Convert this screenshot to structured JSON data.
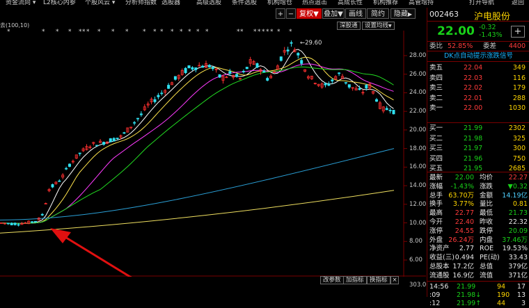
{
  "menubar": {
    "items": [
      "资金流向 ▾",
      "L2核心内参",
      "个股风云 ▾",
      "分析师指数",
      "选股器",
      "高级选股",
      "条件选股",
      "机构增仓",
      "热点追击",
      "高成长性",
      "机构推荐",
      "高管增持",
      "打开导航",
      "返回"
    ]
  },
  "toolbar": {
    "plus": "+",
    "minus": "−",
    "right_adjust": "复权",
    "overlay": "叠加",
    "line": "画线",
    "simple": "简约",
    "hide": "隐藏",
    "hide_arrow": "▶"
  },
  "stock": {
    "code": "002463",
    "name": "沪电股份",
    "price": "22.00",
    "change": "-0.32",
    "change_pct": "-1.43%",
    "add": "+"
  },
  "chart": {
    "indicator_label": "去(100,10)",
    "source_btn": "深股通",
    "settings_btn": "设置均线",
    "peak_label": "29.60",
    "y_ticks": [
      "28.00",
      "26.00",
      "24.00",
      "22.00",
      "20.00",
      "18.00",
      "16.00",
      "14.00",
      "12.00",
      "10.00",
      "8.00",
      "6.00"
    ],
    "vol_tick": "303.00",
    "bottom_buttons": [
      "改参数",
      "加指标",
      "换指标"
    ],
    "close_x": "×",
    "colors": {
      "up": "#ff3030",
      "down": "#30e0f0",
      "ma5": "#ffffff",
      "ma10": "#ffe44d",
      "ma20": "#ff3bff",
      "ma30": "#22dd22",
      "ma60": "#2a9fd6",
      "ma120": "#f0e060",
      "arrow": "#e01010"
    }
  },
  "ratio": {
    "label": "委比",
    "value": "52.85%",
    "diff_label": "委差",
    "diff_value": "4400"
  },
  "signal": "DK点自动提示涨跌信号",
  "asks": [
    {
      "label": "卖五",
      "price": "22.04",
      "vol": "349"
    },
    {
      "label": "卖四",
      "price": "22.03",
      "vol": "116"
    },
    {
      "label": "卖三",
      "price": "22.02",
      "vol": "179"
    },
    {
      "label": "卖二",
      "price": "22.01",
      "vol": "288"
    },
    {
      "label": "卖一",
      "price": "22.00",
      "vol": "1030"
    }
  ],
  "bids": [
    {
      "label": "买一",
      "price": "21.99",
      "vol": "2302"
    },
    {
      "label": "买二",
      "price": "21.98",
      "vol": "325"
    },
    {
      "label": "买三",
      "price": "21.97",
      "vol": "300"
    },
    {
      "label": "买四",
      "price": "21.96",
      "vol": "750"
    },
    {
      "label": "买五",
      "price": "21.95",
      "vol": "2685"
    }
  ],
  "stats": [
    {
      "l1": "最新",
      "v1": "22.00",
      "c1": "green",
      "l2": "均价",
      "v2": "22.27",
      "c2": "red"
    },
    {
      "l1": "涨幅",
      "v1": "-1.43%",
      "c1": "green",
      "l2": "涨跌",
      "v2": "▼0.32",
      "c2": "green"
    },
    {
      "l1": "总手",
      "v1": "63.70万",
      "c1": "yellow",
      "l2": "金额",
      "v2": "14.19亿",
      "c2": "cyan"
    },
    {
      "l1": "换手",
      "v1": "3.77%",
      "c1": "yellow",
      "l2": "量比",
      "v2": "0.81",
      "c2": "yellow"
    },
    {
      "l1": "最高",
      "v1": "22.77",
      "c1": "red",
      "l2": "最低",
      "v2": "21.73",
      "c2": "green"
    },
    {
      "l1": "今开",
      "v1": "22.40",
      "c1": "red",
      "l2": "昨收",
      "v2": "22.32",
      "c2": "white"
    },
    {
      "l1": "涨停",
      "v1": "24.55",
      "c1": "red",
      "l2": "跌停",
      "v2": "20.09",
      "c2": "green"
    },
    {
      "l1": "外盘",
      "v1": "26.24万",
      "c1": "red",
      "l2": "内盘",
      "v2": "37.46万",
      "c2": "green"
    },
    {
      "l1": "净资产",
      "v1": "2.77",
      "c1": "white",
      "l2": "ROE",
      "v2": "19.53%",
      "c2": "white"
    },
    {
      "l1": "收益(三)",
      "v1": "0.494",
      "c1": "white",
      "l2": "PE(动)",
      "v2": "33.43",
      "c2": "white"
    },
    {
      "l1": "总股本",
      "v1": "17.2亿",
      "c1": "white",
      "l2": "总值",
      "v2": "379亿",
      "c2": "white"
    },
    {
      "l1": "流通股",
      "v1": "16.9亿",
      "c1": "white",
      "l2": "流值",
      "v2": "371亿",
      "c2": "white"
    }
  ],
  "ticks": [
    {
      "time": "14:56",
      "price": "21.99",
      "vol": "94",
      "count": "17"
    },
    {
      "time": ":09",
      "price": "21.98↓",
      "vol": "190",
      "count": "13"
    },
    {
      "time": ":12",
      "price": "21.99↑",
      "vol": "44",
      "count": "3"
    }
  ]
}
